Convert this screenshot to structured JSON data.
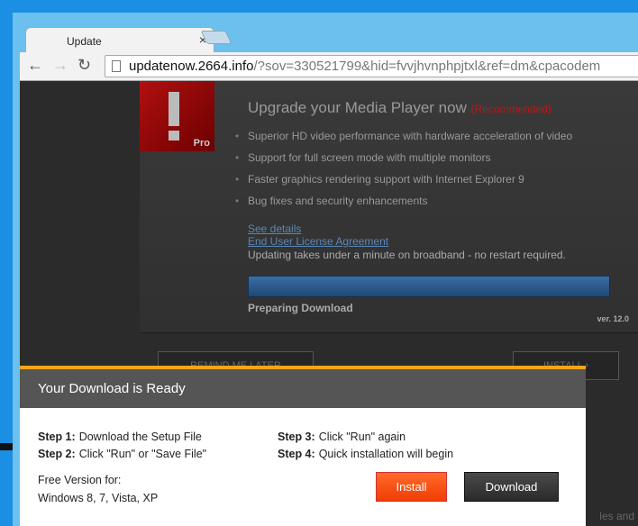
{
  "browser": {
    "tab_title": "Update",
    "url_host": "updatenow.2664.info",
    "url_rest": "/?sov=330521799&hid=fvvjhvnphpjtxl&ref=dm&cpacodem"
  },
  "panel": {
    "icon_label": "Pro",
    "title": "Upgrade your Media Player now",
    "recommended": "(Recommended)",
    "bullets": [
      "Superior HD video performance with hardware acceleration of video",
      "Support for full screen mode with multiple monitors",
      "Faster graphics rendering support with Internet Explorer 9",
      "Bug fixes and security enhancements"
    ],
    "see_details": "See details",
    "eula": "End User License Agreement",
    "note": "Updating takes under a minute on broadband - no restart required.",
    "status": "Preparing Download",
    "version": "ver. 12.0",
    "remind": "REMIND ME LATER",
    "install": "INSTALL ›"
  },
  "popup": {
    "title": "Your Download is Ready",
    "steps": [
      {
        "label": "Step 1:",
        "text": "Download the Setup File"
      },
      {
        "label": "Step 2:",
        "text": "Click \"Run\" or \"Save File\""
      },
      {
        "label": "Step 3:",
        "text": "Click \"Run\" again"
      },
      {
        "label": "Step 4:",
        "text": "Quick installation will begin"
      }
    ],
    "free_line1": "Free Version for:",
    "free_line2": "Windows 8, 7, Vista, XP",
    "install": "Install",
    "download": "Download"
  },
  "background_fragment": "les and",
  "colors": {
    "accent": "#f0a818",
    "install": "#f24a10",
    "recommended": "#c01515"
  }
}
